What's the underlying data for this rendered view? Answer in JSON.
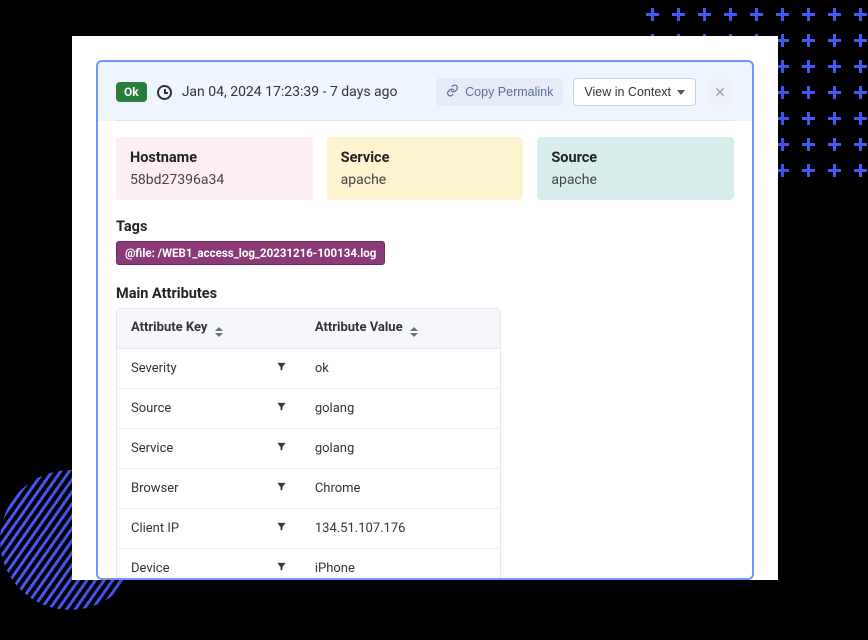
{
  "header": {
    "status_label": "Ok",
    "timestamp": "Jan 04, 2024 17:23:39 - 7 days ago",
    "copy_label": "Copy Permalink",
    "view_context_label": "View in Context"
  },
  "info_cards": {
    "hostname": {
      "label": "Hostname",
      "value": "58bd27396a34"
    },
    "service": {
      "label": "Service",
      "value": "apache"
    },
    "source": {
      "label": "Source",
      "value": "apache"
    }
  },
  "tags": {
    "section_title": "Tags",
    "items": [
      "@file: /WEB1_access_log_20231216-100134.log"
    ]
  },
  "attributes": {
    "section_title": "Main Attributes",
    "columns": {
      "key": "Attribute Key",
      "value": "Attribute Value"
    },
    "rows": [
      {
        "key": "Severity",
        "value": "ok"
      },
      {
        "key": "Source",
        "value": "golang"
      },
      {
        "key": "Service",
        "value": "golang"
      },
      {
        "key": "Browser",
        "value": "Chrome"
      },
      {
        "key": "Client IP",
        "value": "134.51.107.176"
      },
      {
        "key": "Device",
        "value": "iPhone"
      }
    ]
  }
}
